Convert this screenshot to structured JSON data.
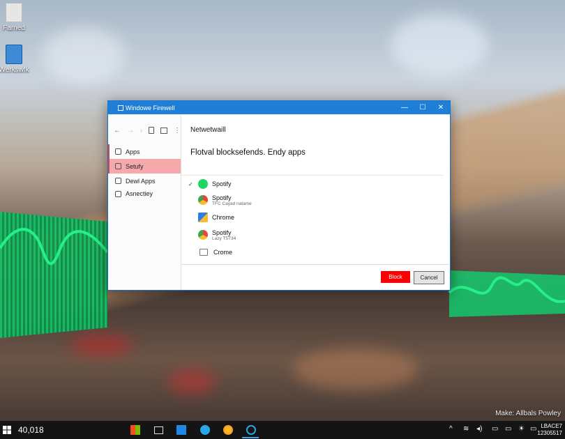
{
  "desktop": {
    "icons": [
      {
        "label": "Farned",
        "color": "#d8d8d8"
      },
      {
        "label": "Werkswfk",
        "color": "#3d8ad6"
      }
    ],
    "watermark": "Make: Allbals Powley"
  },
  "window": {
    "title": "Windowe Firewell",
    "minimize": "—",
    "maximize": "☐",
    "close": "✕",
    "nav": {
      "back": "←",
      "forward": "→",
      "up": "›"
    },
    "sidebar": [
      {
        "label": "Apps",
        "active": false
      },
      {
        "label": "Setufy",
        "active": true
      },
      {
        "label": "Dewl Apps",
        "active": false
      },
      {
        "label": "Asnectiey",
        "active": false
      }
    ],
    "heading": "Netwetwaill",
    "subheading": "Flotval blocksefends. Endy apps",
    "apps": [
      {
        "name": "Spotify",
        "sub": "",
        "icon": "spotify-icon",
        "checked": true,
        "color": "#1ed760"
      },
      {
        "name": "Spotify",
        "sub": "TFC Cayad natame",
        "icon": "chrome-icon",
        "checked": false,
        "color": "#e8453c"
      },
      {
        "name": "Chrome",
        "sub": "",
        "icon": "chrome-file-icon",
        "checked": false,
        "color": "#2f7de1"
      },
      {
        "name": "Spotify",
        "sub": "Lazy T5T34",
        "icon": "chrome-icon",
        "checked": false,
        "color": "#e8453c"
      },
      {
        "name": "Crome",
        "sub": "",
        "icon": "folder-icon",
        "checked": false,
        "color": "#888888"
      }
    ],
    "buttons": {
      "block": "Block",
      "cancel": "Cancel"
    }
  },
  "taskbar": {
    "search_text": "40,018",
    "tray": {
      "chevron": "^",
      "wifi": "≋",
      "volume": "◂)",
      "weather": "☀"
    },
    "clock": {
      "line1": "LBACE7",
      "line2": "12305517"
    }
  },
  "colors": {
    "accent": "#1f7fd6",
    "block": "#ff0000",
    "active_item": "#f6a9aa",
    "wave": "#19e07a"
  }
}
